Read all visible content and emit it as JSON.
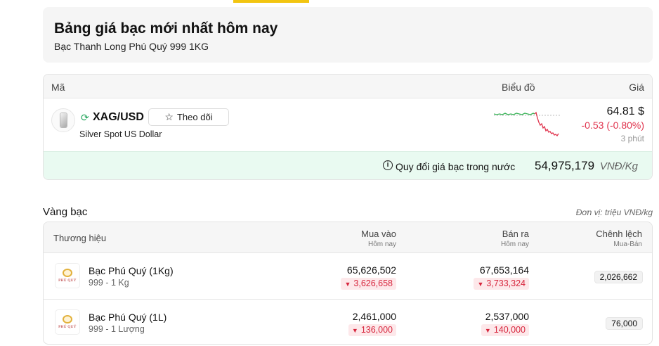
{
  "header": {
    "title": "Bảng giá bạc mới nhất hôm nay",
    "subtitle": "Bạc Thanh Long Phú Quý 999 1KG"
  },
  "quote": {
    "columns": {
      "code": "Mã",
      "chart": "Biểu đồ",
      "price": "Giá"
    },
    "symbol": "XAG/USD",
    "follow_label": "Theo dõi",
    "name": "Silver Spot US Dollar",
    "price": "64.81 $",
    "change": "-0.53 (-0.80%)",
    "updated": "3 phút",
    "convert_label": "Quy đổi giá bạc trong nước",
    "convert_value": "54,975,179",
    "convert_unit": "VNĐ/Kg",
    "colors": {
      "up": "#22a55a",
      "down": "#e0334d",
      "convert_bg": "#e9faf1"
    }
  },
  "section": {
    "title": "Vàng bạc",
    "unit_note": "Đơn vị: triệu VNĐ/kg"
  },
  "table": {
    "headers": {
      "brand": "Thương hiệu",
      "buy": "Mua vào",
      "buy_sub": "Hôm nay",
      "sell": "Bán ra",
      "sell_sub": "Hôm nay",
      "diff": "Chênh lệch",
      "diff_sub": "Mua-Bán"
    },
    "logo_text": "PHÚ QUÝ",
    "rows": [
      {
        "name": "Bạc Phú Quý (1Kg)",
        "spec": "999 - 1 Kg",
        "buy": "65,626,502",
        "buy_change": "3,626,658",
        "sell": "67,653,164",
        "sell_change": "3,733,324",
        "diff": "2,026,662"
      },
      {
        "name": "Bạc Phú Quý (1L)",
        "spec": "999 - 1 Lượng",
        "buy": "2,461,000",
        "buy_change": "136,000",
        "sell": "2,537,000",
        "sell_change": "140,000",
        "diff": "76,000"
      }
    ]
  }
}
